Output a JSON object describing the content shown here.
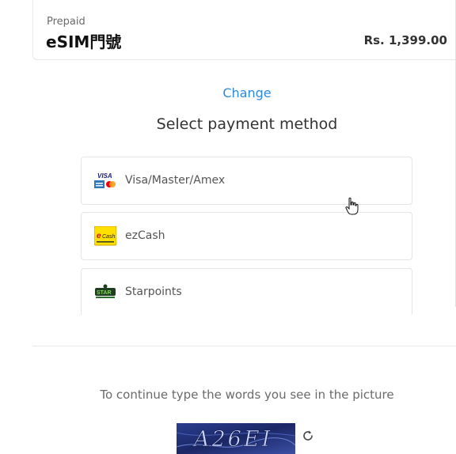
{
  "product": {
    "plan_type": "Prepaid",
    "name": "eSIM門號",
    "price": "Rs. 1,399.00"
  },
  "change_link": "Change",
  "payment": {
    "title": "Select payment method",
    "options": [
      {
        "label": "Visa/Master/Amex",
        "icon": "card-networks-icon"
      },
      {
        "label": "ezCash",
        "icon": "ezcash-logo-icon"
      },
      {
        "label": "Starpoints",
        "icon": "starpoints-logo-icon"
      }
    ]
  },
  "captcha": {
    "instruction": "To continue type the words you see in the picture",
    "image_text": "A26EI",
    "refresh_icon": "refresh-icon"
  },
  "colors": {
    "link": "#2b8ae0",
    "border": "#e5e5e5",
    "captcha_bg": "#1f2f7a"
  }
}
